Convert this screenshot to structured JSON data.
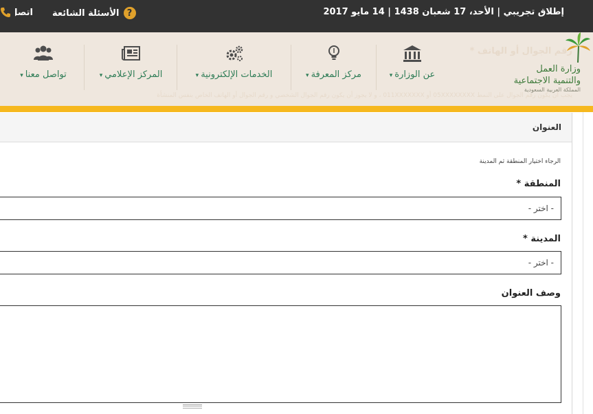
{
  "topbar": {
    "date_text": "إطلاق تجريبي | الأحد، 17 شعبان 1438 | 14 مايو 2017",
    "faq_label": "الأسئلة الشائعة",
    "faq_icon_char": "?",
    "contact_label": "اتصل بنا"
  },
  "header": {
    "ghost_text_1": "رقم الجوال أو الهاتف *",
    "ghost_text_2": "يجب أن يكون رقم الجوال على النمط 05XXXXXXXX أو 011XXXXXXX ، و لا يجوز أن يكون رقم الجوال الشخصي و رقم الجوال أو الهاتف الخاص بنفس المنشأة",
    "logo": {
      "line1": "وزارة العمل",
      "line2": "والتنمية الاجتماعية",
      "line3": "المملكة العربية السعودية"
    },
    "nav": [
      {
        "label": "عن الوزارة",
        "icon": "building-icon"
      },
      {
        "label": "مركز المعرفة",
        "icon": "lightbulb-icon"
      },
      {
        "label": "الخدمات الإلكترونية",
        "icon": "gears-icon"
      },
      {
        "label": "المركز الإعلامي",
        "icon": "newspaper-icon"
      },
      {
        "label": "تواصل معنا",
        "icon": "users-icon"
      }
    ],
    "caret": "▾"
  },
  "form": {
    "panel_title": "العنوان",
    "hint": "الرجاء اختيار المنطقة ثم المدينة",
    "region_label": "المنطقة *",
    "region_value": "- اختر -",
    "city_label": "المدينة *",
    "city_value": "- اختر -",
    "description_label": "وصف العنوان",
    "description_value": ""
  },
  "colors": {
    "topbar": "#323232",
    "header_bg": "#efe7de",
    "accent_gold": "#f6b81e",
    "nav_green": "#2f7d57",
    "faq_icon": "#e0a12b"
  }
}
